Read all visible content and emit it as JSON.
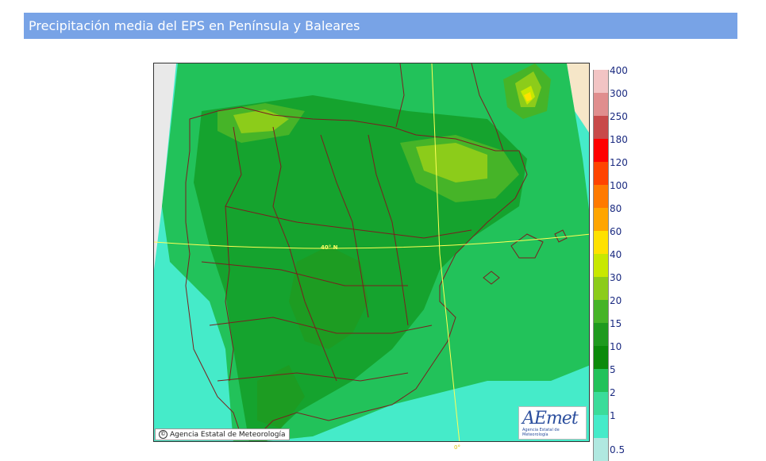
{
  "header": {
    "title": "Precipitación media del EPS en Península y Baleares"
  },
  "map": {
    "copyright_text": "Agencia Estatal de Meteorología",
    "copyright_symbol": "©",
    "logo_text": "AEmet",
    "logo_subtext": "Agencia Estatal de Meteorología",
    "latitude_label": "40° N",
    "longitude_label": "0°"
  },
  "legend": {
    "items": [
      {
        "label": "400",
        "color": "#f2c4c4"
      },
      {
        "label": "300",
        "color": "#e08e8e"
      },
      {
        "label": "250",
        "color": "#c84a4a"
      },
      {
        "label": "180",
        "color": "#ff0000"
      },
      {
        "label": "120",
        "color": "#ff4400"
      },
      {
        "label": "100",
        "color": "#ff7a00"
      },
      {
        "label": "80",
        "color": "#ffa500"
      },
      {
        "label": "60",
        "color": "#ffe100"
      },
      {
        "label": "40",
        "color": "#c8e800"
      },
      {
        "label": "30",
        "color": "#8ccc1a"
      },
      {
        "label": "20",
        "color": "#46b428"
      },
      {
        "label": "15",
        "color": "#1f9a1f"
      },
      {
        "label": "10",
        "color": "#0b8a0b"
      },
      {
        "label": "5",
        "color": "#22c25a"
      },
      {
        "label": "2",
        "color": "#3bdc9a"
      },
      {
        "label": "1",
        "color": "#45ebc9"
      },
      {
        "label": "0.5",
        "color": "#b0e8e0"
      }
    ]
  }
}
